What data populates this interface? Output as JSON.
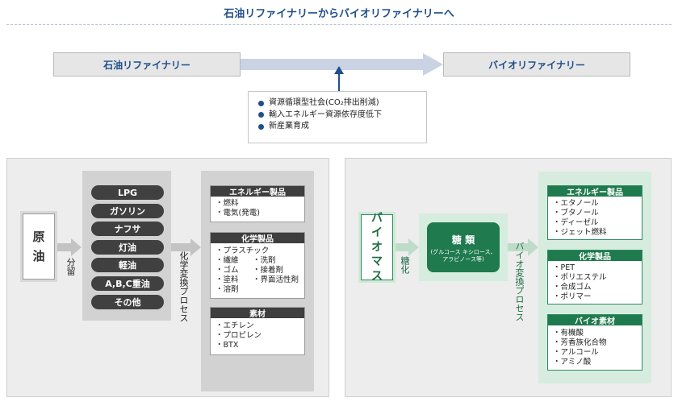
{
  "title": "石油リファイナリーからバイオリファイナリーへ",
  "top": {
    "petro_refinery": "石油リファイナリー",
    "bio_refinery": "バイオリファイナリー",
    "benefits": [
      "資源循環型社会(CO₂排出削減)",
      "輸入エネルギー資源依存度低下",
      "新産業育成"
    ]
  },
  "left": {
    "feed": [
      "原",
      "油"
    ],
    "distill_label": "分留",
    "fractions": [
      "LPG",
      "ガソリン",
      "ナフサ",
      "灯油",
      "軽油",
      "A,B,C重油",
      "その他"
    ],
    "conversion_label": "化学変換プロセス",
    "categories": {
      "energy": {
        "title": "エネルギー製品",
        "items": [
          "・燃料",
          "・電気(発電)"
        ]
      },
      "chemical": {
        "title": "化学製品",
        "col1": [
          "・プラスチック",
          "・繊維",
          "・ゴム",
          "・塗料",
          "・溶剤"
        ],
        "col2": [
          "・洗剤",
          "・接着剤",
          "・界面活性剤"
        ]
      },
      "material": {
        "title": "素材",
        "items": [
          "・エチレン",
          "・プロピレン",
          "・BTX"
        ]
      }
    }
  },
  "right": {
    "feed": [
      "バ",
      "イ",
      "オ",
      "マ",
      "ス"
    ],
    "saccharify_label": "糖化",
    "sugar_title": "糖 類",
    "sugar_sub": "(グルコース キシロース、アラビノース等)",
    "conversion_label": "バイオ変換プロセス",
    "categories": {
      "energy": {
        "title": "エネルギー製品",
        "items": [
          "・エタノール",
          "・ブタノール",
          "・ディーゼル",
          "・ジェット燃料"
        ]
      },
      "chemical": {
        "title": "化学製品",
        "items": [
          "・PET",
          "・ポリエステル",
          "・合成ゴム",
          "・ポリマー"
        ]
      },
      "material": {
        "title": "バイオ素材",
        "items": [
          "・有機酸",
          "・芳香族化合物",
          "・アルコール",
          "・アミノ酸"
        ]
      }
    }
  },
  "colors": {
    "accent_blue": "#1f4e8c",
    "accent_green": "#1f7a4e",
    "flow_arrow": "#c9d3e3"
  }
}
